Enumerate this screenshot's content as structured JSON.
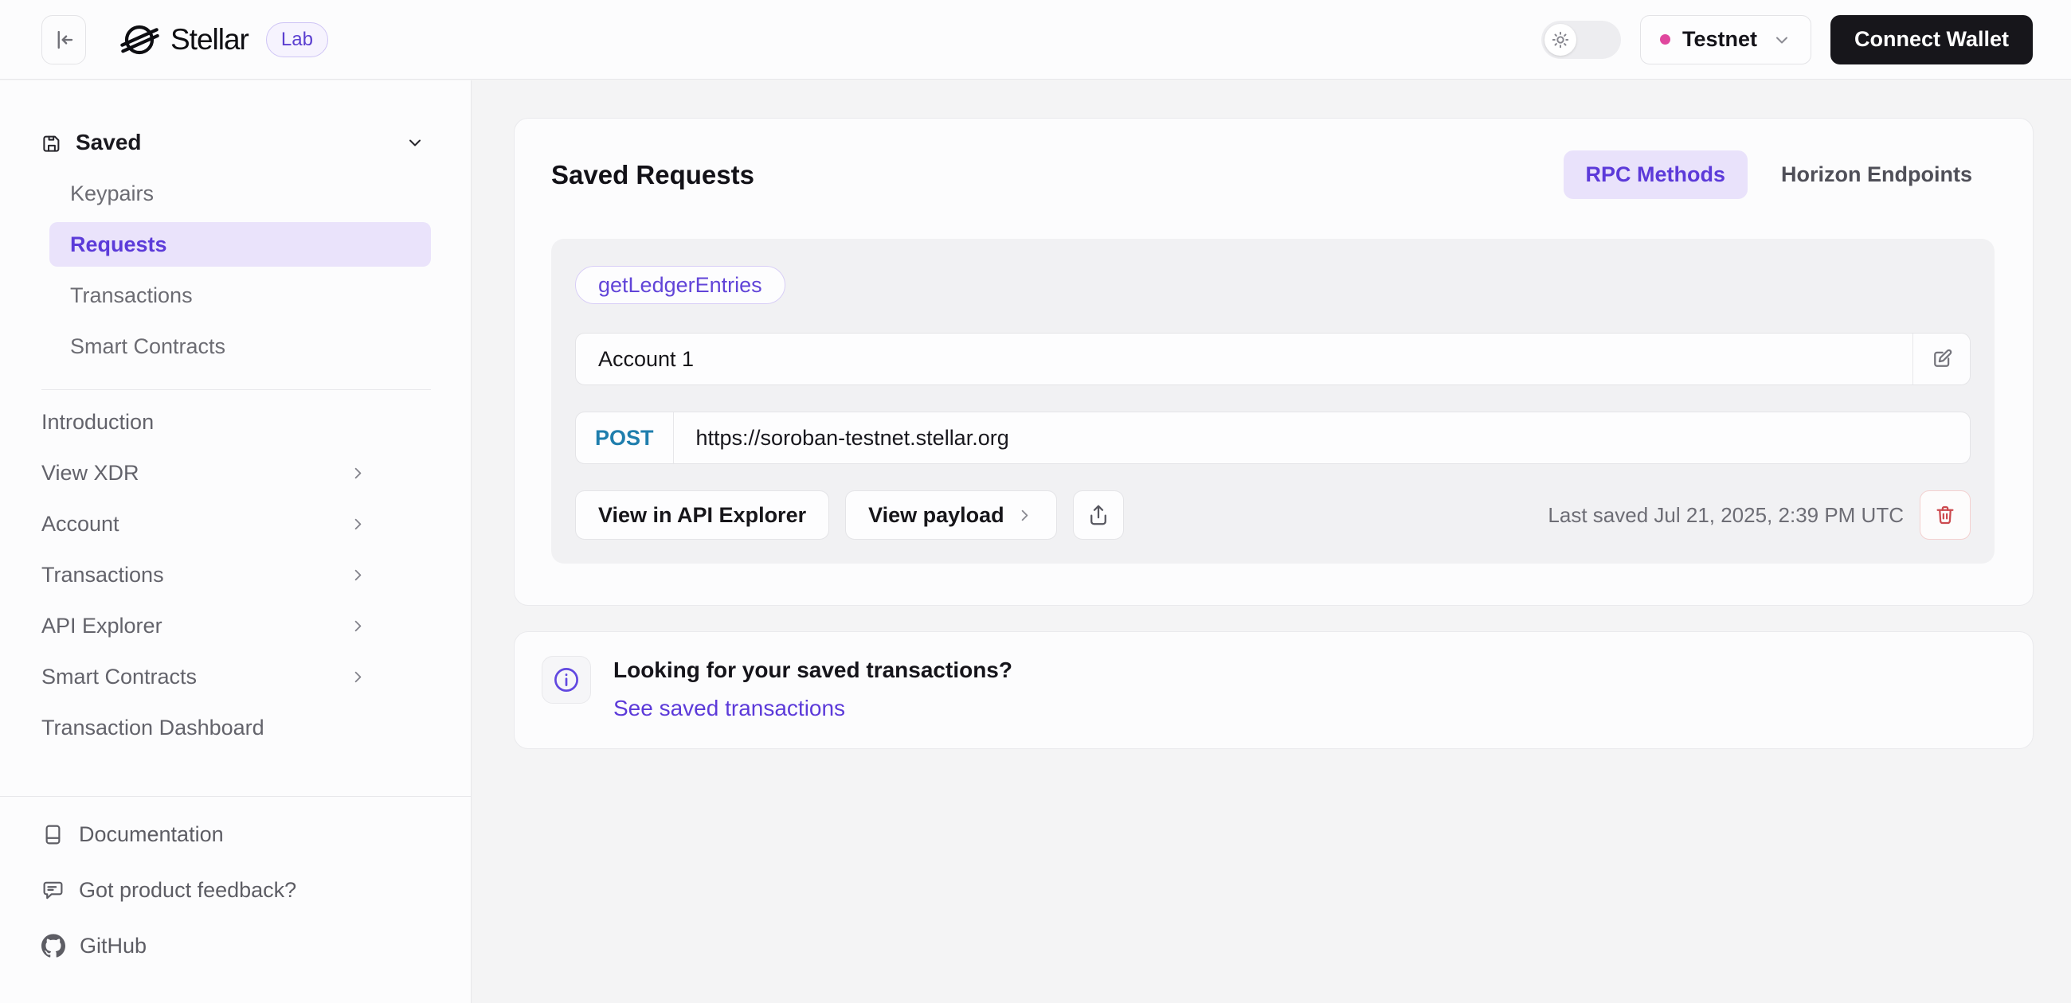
{
  "header": {
    "brand": "Stellar",
    "badge": "Lab",
    "network": {
      "label": "Testnet"
    },
    "connect_wallet_label": "Connect Wallet"
  },
  "sidebar": {
    "saved": {
      "label": "Saved",
      "items": [
        {
          "label": "Keypairs",
          "active": false
        },
        {
          "label": "Requests",
          "active": true
        },
        {
          "label": "Transactions",
          "active": false
        },
        {
          "label": "Smart Contracts",
          "active": false
        }
      ]
    },
    "nav": [
      {
        "label": "Introduction",
        "has_submenu": false
      },
      {
        "label": "View XDR",
        "has_submenu": true
      },
      {
        "label": "Account",
        "has_submenu": true
      },
      {
        "label": "Transactions",
        "has_submenu": true
      },
      {
        "label": "API Explorer",
        "has_submenu": true
      },
      {
        "label": "Smart Contracts",
        "has_submenu": true
      },
      {
        "label": "Transaction Dashboard",
        "has_submenu": false
      }
    ],
    "footer": [
      {
        "label": "Documentation",
        "icon": "book-icon"
      },
      {
        "label": "Got product feedback?",
        "icon": "feedback-icon"
      },
      {
        "label": "GitHub",
        "icon": "github-icon"
      }
    ]
  },
  "main": {
    "title": "Saved Requests",
    "tabs": [
      {
        "label": "RPC Methods",
        "active": true
      },
      {
        "label": "Horizon Endpoints",
        "active": false
      }
    ],
    "request": {
      "method_badge": "getLedgerEntries",
      "name_value": "Account 1",
      "http_method": "POST",
      "url": "https://soroban-testnet.stellar.org",
      "view_api_explorer_label": "View in API Explorer",
      "view_payload_label": "View payload",
      "last_saved": "Last saved Jul 21, 2025, 2:39 PM UTC"
    },
    "info": {
      "question": "Looking for your saved transactions?",
      "link_label": "See saved transactions"
    }
  },
  "colors": {
    "accent_purple": "#5C3AD9",
    "accent_purple_bg": "#E9E2FB",
    "network_dot_pink": "#E0479E",
    "post_method_teal": "#1F7EAD",
    "delete_red": "#CC4A4F"
  }
}
